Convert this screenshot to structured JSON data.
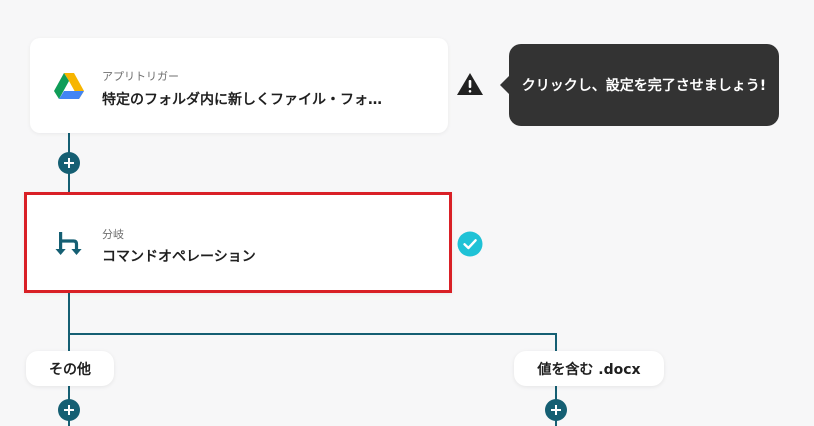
{
  "trigger_card": {
    "subtitle": "アプリトリガー",
    "title": "特定のフォルダ内に新しくファイル・フォ…",
    "icon": "google-drive-icon"
  },
  "tooltip": {
    "text": "クリックし、設定を完了させましょう!",
    "icon": "warning-icon"
  },
  "branch_card": {
    "subtitle": "分岐",
    "title": "コマンドオペレーション",
    "icon": "branch-icon",
    "status_icon": "check-circle-icon"
  },
  "branches": [
    {
      "label": "その他"
    },
    {
      "label": "値を含む .docx"
    }
  ],
  "colors": {
    "accent": "#155f73",
    "selection_border": "#d92026",
    "check": "#1fc2d6",
    "tooltip_bg": "#333333",
    "background": "#f7f7f8"
  }
}
